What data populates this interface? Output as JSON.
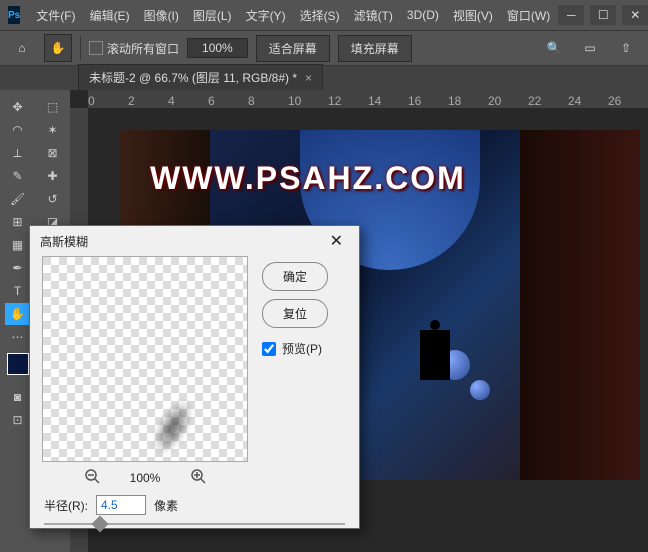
{
  "menu": [
    "文件(F)",
    "编辑(E)",
    "图像(I)",
    "图层(L)",
    "文字(Y)",
    "选择(S)",
    "滤镜(T)",
    "3D(D)",
    "视图(V)",
    "窗口(W)"
  ],
  "options": {
    "scroll_all": "滚动所有窗口",
    "zoom": "100%",
    "fit_screen": "适合屏幕",
    "fill_screen": "填充屏幕"
  },
  "tab": {
    "label": "未标题-2 @ 66.7% (图层 11, RGB/8#) *"
  },
  "ruler": [
    "0",
    "2",
    "4",
    "6",
    "8",
    "10",
    "12",
    "14",
    "16",
    "18",
    "20",
    "22",
    "24",
    "26"
  ],
  "watermark": "WWW.PSAHZ.COM",
  "dialog": {
    "title": "高斯模糊",
    "ok": "确定",
    "reset": "复位",
    "preview": "预览(P)",
    "zoom": "100%",
    "radius_lbl": "半径(R):",
    "radius_val": "4.5",
    "radius_unit": "像素"
  },
  "swatches": {
    "fg": "#0a1840",
    "bg": "#ffffff"
  }
}
